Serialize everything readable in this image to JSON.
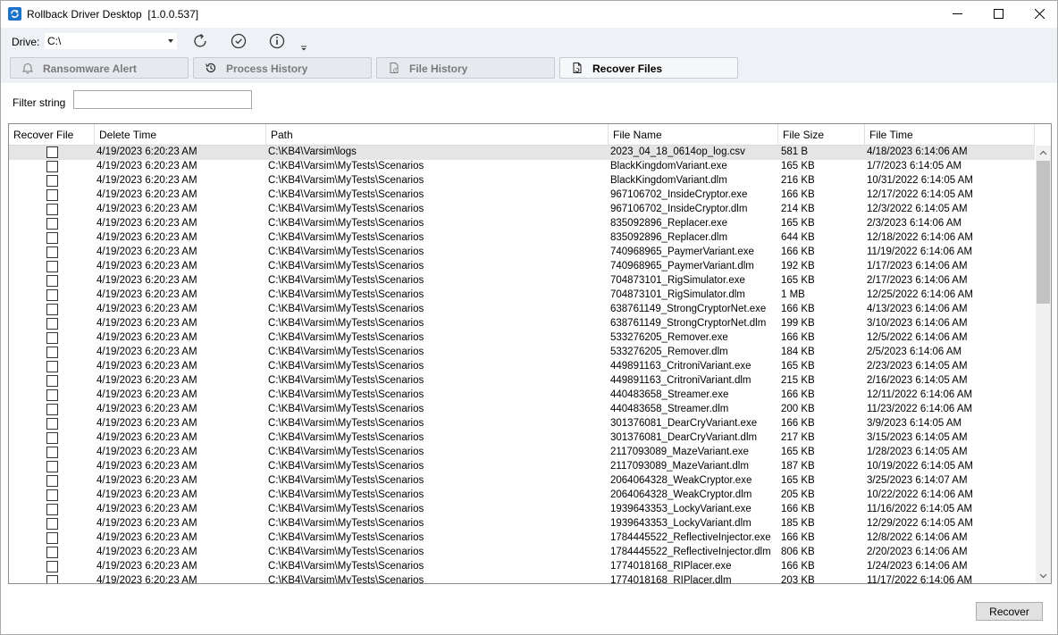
{
  "window": {
    "title": "Rollback Driver Desktop  [1.0.0.537]"
  },
  "toolbar": {
    "drive_label": "Drive:",
    "drive_value": "C:\\",
    "icons": [
      "refresh-icon",
      "check-circle-icon",
      "info-icon"
    ]
  },
  "tabs": [
    {
      "label": "Ransomware Alert",
      "icon": "bell-icon",
      "active": false
    },
    {
      "label": "Process History",
      "icon": "history-icon",
      "active": false
    },
    {
      "label": "File History",
      "icon": "file-history-icon",
      "active": false
    },
    {
      "label": "Recover Files",
      "icon": "recover-file-icon",
      "active": true
    }
  ],
  "filter": {
    "label": "Filter string",
    "value": ""
  },
  "grid": {
    "columns": [
      "Recover File",
      "Delete Time",
      "Path",
      "File Name",
      "File Size",
      "File Time"
    ],
    "rows": [
      {
        "delete_time": "4/19/2023 6:20:23 AM",
        "path": "C:\\KB4\\Varsim\\logs",
        "file_name": "2023_04_18_0614op_log.csv",
        "file_size": "581 B",
        "file_time": "4/18/2023 6:14:06 AM"
      },
      {
        "delete_time": "4/19/2023 6:20:23 AM",
        "path": "C:\\KB4\\Varsim\\MyTests\\Scenarios",
        "file_name": "BlackKingdomVariant.exe",
        "file_size": "165 KB",
        "file_time": "1/7/2023 6:14:05 AM"
      },
      {
        "delete_time": "4/19/2023 6:20:23 AM",
        "path": "C:\\KB4\\Varsim\\MyTests\\Scenarios",
        "file_name": "BlackKingdomVariant.dlm",
        "file_size": "216 KB",
        "file_time": "10/31/2022 6:14:05 AM"
      },
      {
        "delete_time": "4/19/2023 6:20:23 AM",
        "path": "C:\\KB4\\Varsim\\MyTests\\Scenarios",
        "file_name": "967106702_InsideCryptor.exe",
        "file_size": "166 KB",
        "file_time": "12/17/2022 6:14:05 AM"
      },
      {
        "delete_time": "4/19/2023 6:20:23 AM",
        "path": "C:\\KB4\\Varsim\\MyTests\\Scenarios",
        "file_name": "967106702_InsideCryptor.dlm",
        "file_size": "214 KB",
        "file_time": "12/3/2022 6:14:05 AM"
      },
      {
        "delete_time": "4/19/2023 6:20:23 AM",
        "path": "C:\\KB4\\Varsim\\MyTests\\Scenarios",
        "file_name": "835092896_Replacer.exe",
        "file_size": "165 KB",
        "file_time": "2/3/2023 6:14:06 AM"
      },
      {
        "delete_time": "4/19/2023 6:20:23 AM",
        "path": "C:\\KB4\\Varsim\\MyTests\\Scenarios",
        "file_name": "835092896_Replacer.dlm",
        "file_size": "644 KB",
        "file_time": "12/18/2022 6:14:06 AM"
      },
      {
        "delete_time": "4/19/2023 6:20:23 AM",
        "path": "C:\\KB4\\Varsim\\MyTests\\Scenarios",
        "file_name": "740968965_PaymerVariant.exe",
        "file_size": "166 KB",
        "file_time": "11/19/2022 6:14:06 AM"
      },
      {
        "delete_time": "4/19/2023 6:20:23 AM",
        "path": "C:\\KB4\\Varsim\\MyTests\\Scenarios",
        "file_name": "740968965_PaymerVariant.dlm",
        "file_size": "192 KB",
        "file_time": "1/17/2023 6:14:06 AM"
      },
      {
        "delete_time": "4/19/2023 6:20:23 AM",
        "path": "C:\\KB4\\Varsim\\MyTests\\Scenarios",
        "file_name": "704873101_RigSimulator.exe",
        "file_size": "165 KB",
        "file_time": "2/17/2023 6:14:06 AM"
      },
      {
        "delete_time": "4/19/2023 6:20:23 AM",
        "path": "C:\\KB4\\Varsim\\MyTests\\Scenarios",
        "file_name": "704873101_RigSimulator.dlm",
        "file_size": "1 MB",
        "file_time": "12/25/2022 6:14:06 AM"
      },
      {
        "delete_time": "4/19/2023 6:20:23 AM",
        "path": "C:\\KB4\\Varsim\\MyTests\\Scenarios",
        "file_name": "638761149_StrongCryptorNet.exe",
        "file_size": "166 KB",
        "file_time": "4/13/2023 6:14:06 AM"
      },
      {
        "delete_time": "4/19/2023 6:20:23 AM",
        "path": "C:\\KB4\\Varsim\\MyTests\\Scenarios",
        "file_name": "638761149_StrongCryptorNet.dlm",
        "file_size": "199 KB",
        "file_time": "3/10/2023 6:14:06 AM"
      },
      {
        "delete_time": "4/19/2023 6:20:23 AM",
        "path": "C:\\KB4\\Varsim\\MyTests\\Scenarios",
        "file_name": "533276205_Remover.exe",
        "file_size": "166 KB",
        "file_time": "12/5/2022 6:14:06 AM"
      },
      {
        "delete_time": "4/19/2023 6:20:23 AM",
        "path": "C:\\KB4\\Varsim\\MyTests\\Scenarios",
        "file_name": "533276205_Remover.dlm",
        "file_size": "184 KB",
        "file_time": "2/5/2023 6:14:06 AM"
      },
      {
        "delete_time": "4/19/2023 6:20:23 AM",
        "path": "C:\\KB4\\Varsim\\MyTests\\Scenarios",
        "file_name": "449891163_CritroniVariant.exe",
        "file_size": "165 KB",
        "file_time": "2/23/2023 6:14:05 AM"
      },
      {
        "delete_time": "4/19/2023 6:20:23 AM",
        "path": "C:\\KB4\\Varsim\\MyTests\\Scenarios",
        "file_name": "449891163_CritroniVariant.dlm",
        "file_size": "215 KB",
        "file_time": "2/16/2023 6:14:05 AM"
      },
      {
        "delete_time": "4/19/2023 6:20:23 AM",
        "path": "C:\\KB4\\Varsim\\MyTests\\Scenarios",
        "file_name": "440483658_Streamer.exe",
        "file_size": "166 KB",
        "file_time": "12/11/2022 6:14:06 AM"
      },
      {
        "delete_time": "4/19/2023 6:20:23 AM",
        "path": "C:\\KB4\\Varsim\\MyTests\\Scenarios",
        "file_name": "440483658_Streamer.dlm",
        "file_size": "200 KB",
        "file_time": "11/23/2022 6:14:06 AM"
      },
      {
        "delete_time": "4/19/2023 6:20:23 AM",
        "path": "C:\\KB4\\Varsim\\MyTests\\Scenarios",
        "file_name": "301376081_DearCryVariant.exe",
        "file_size": "166 KB",
        "file_time": "3/9/2023 6:14:05 AM"
      },
      {
        "delete_time": "4/19/2023 6:20:23 AM",
        "path": "C:\\KB4\\Varsim\\MyTests\\Scenarios",
        "file_name": "301376081_DearCryVariant.dlm",
        "file_size": "217 KB",
        "file_time": "3/15/2023 6:14:05 AM"
      },
      {
        "delete_time": "4/19/2023 6:20:23 AM",
        "path": "C:\\KB4\\Varsim\\MyTests\\Scenarios",
        "file_name": "2117093089_MazeVariant.exe",
        "file_size": "165 KB",
        "file_time": "1/28/2023 6:14:05 AM"
      },
      {
        "delete_time": "4/19/2023 6:20:23 AM",
        "path": "C:\\KB4\\Varsim\\MyTests\\Scenarios",
        "file_name": "2117093089_MazeVariant.dlm",
        "file_size": "187 KB",
        "file_time": "10/19/2022 6:14:05 AM"
      },
      {
        "delete_time": "4/19/2023 6:20:23 AM",
        "path": "C:\\KB4\\Varsim\\MyTests\\Scenarios",
        "file_name": "2064064328_WeakCryptor.exe",
        "file_size": "165 KB",
        "file_time": "3/25/2023 6:14:07 AM"
      },
      {
        "delete_time": "4/19/2023 6:20:23 AM",
        "path": "C:\\KB4\\Varsim\\MyTests\\Scenarios",
        "file_name": "2064064328_WeakCryptor.dlm",
        "file_size": "205 KB",
        "file_time": "10/22/2022 6:14:06 AM"
      },
      {
        "delete_time": "4/19/2023 6:20:23 AM",
        "path": "C:\\KB4\\Varsim\\MyTests\\Scenarios",
        "file_name": "1939643353_LockyVariant.exe",
        "file_size": "166 KB",
        "file_time": "11/16/2022 6:14:05 AM"
      },
      {
        "delete_time": "4/19/2023 6:20:23 AM",
        "path": "C:\\KB4\\Varsim\\MyTests\\Scenarios",
        "file_name": "1939643353_LockyVariant.dlm",
        "file_size": "185 KB",
        "file_time": "12/29/2022 6:14:05 AM"
      },
      {
        "delete_time": "4/19/2023 6:20:23 AM",
        "path": "C:\\KB4\\Varsim\\MyTests\\Scenarios",
        "file_name": "1784445522_ReflectiveInjector.exe",
        "file_size": "166 KB",
        "file_time": "12/8/2022 6:14:06 AM"
      },
      {
        "delete_time": "4/19/2023 6:20:23 AM",
        "path": "C:\\KB4\\Varsim\\MyTests\\Scenarios",
        "file_name": "1784445522_ReflectiveInjector.dlm",
        "file_size": "806 KB",
        "file_time": "2/20/2023 6:14:06 AM"
      },
      {
        "delete_time": "4/19/2023 6:20:23 AM",
        "path": "C:\\KB4\\Varsim\\MyTests\\Scenarios",
        "file_name": "1774018168_RIPlacer.exe",
        "file_size": "166 KB",
        "file_time": "1/24/2023 6:14:06 AM"
      },
      {
        "delete_time": "4/19/2023 6:20:23 AM",
        "path": "C:\\KB4\\Varsim\\MyTests\\Scenarios",
        "file_name": "1774018168_RIPlacer.dlm",
        "file_size": "203 KB",
        "file_time": "11/17/2022 6:14:06 AM"
      }
    ]
  },
  "actions": {
    "recover_label": "Recover"
  }
}
